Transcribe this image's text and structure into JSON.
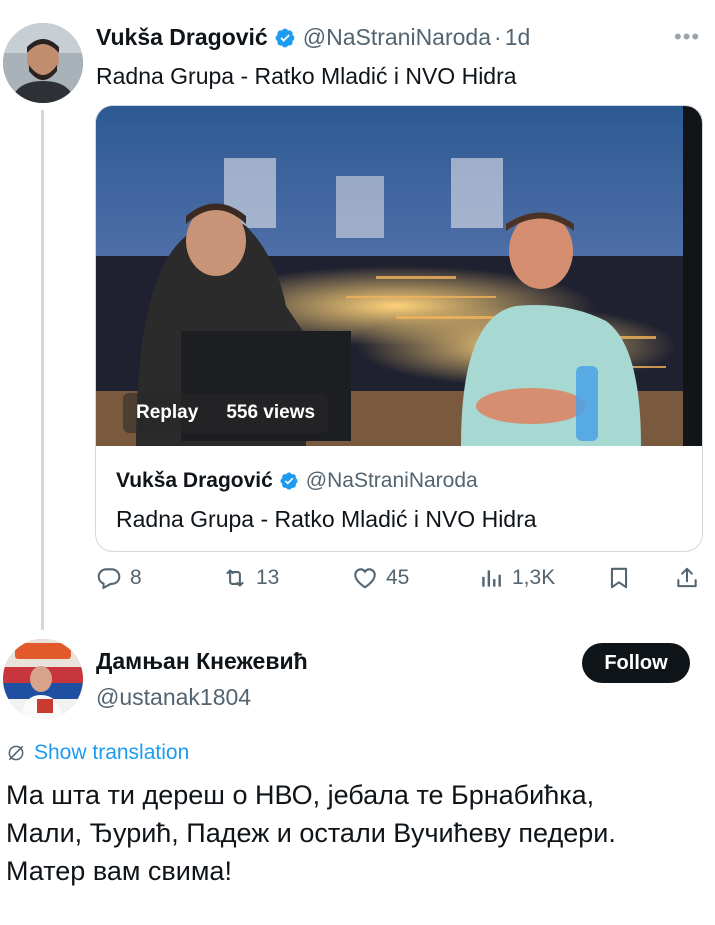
{
  "tweet1": {
    "author_name": "Vukša Dragović",
    "handle": "@NaStraniNaroda",
    "separator": "·",
    "time": "1d",
    "more_icon": "more-horizontal-icon",
    "text": "Radna Grupa - Ratko Mladić i NVO Hidra",
    "quoted": {
      "video": {
        "replay_label": "Replay",
        "views": "556 views"
      },
      "author_name": "Vukša Dragović",
      "handle": "@NaStraniNaroda",
      "text": "Radna Grupa - Ratko Mladić i NVO Hidra"
    },
    "actions": {
      "replies": "8",
      "reposts": "13",
      "likes": "45",
      "views": "1,3K"
    }
  },
  "tweet2": {
    "author_name": "Дамњан Кнежевић",
    "handle": "@ustanak1804",
    "follow_label": "Follow",
    "show_translation": "Show translation",
    "text_lines": [
      "Ма шта ти дереш о НВО, јебала те Брнабићка,",
      "Мали, Ђурић, Падеж и остали Вучићеву педери.",
      "Матер вам свима!"
    ]
  },
  "colors": {
    "verified_blue": "#1d9bf0",
    "text_primary": "#0f1419",
    "text_secondary": "#536471",
    "link_blue": "#1d9bf0",
    "follow_bg": "#0f1419"
  }
}
